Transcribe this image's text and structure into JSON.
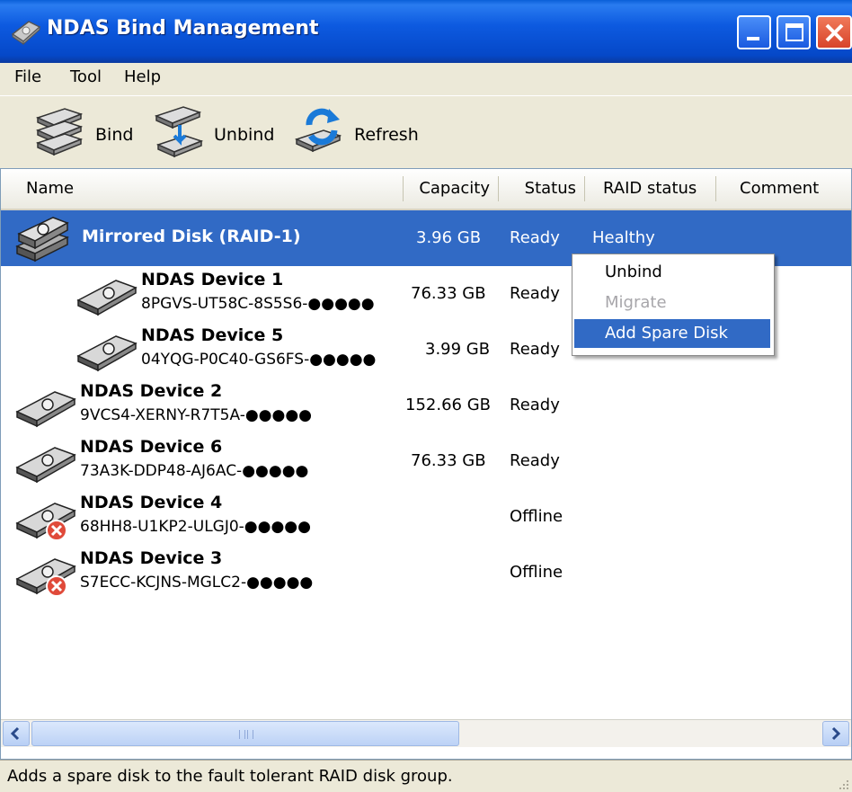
{
  "window": {
    "title": "NDAS Bind Management"
  },
  "menu": [
    "File",
    "Tool",
    "Help"
  ],
  "toolbar": {
    "bind": "Bind",
    "unbind": "Unbind",
    "refresh": "Refresh"
  },
  "columns": [
    "Name",
    "Capacity",
    "Status",
    "RAID status",
    "Comment"
  ],
  "rows": [
    {
      "name": "Mirrored Disk (RAID-1)",
      "serial": "",
      "capacity": "3.96 GB",
      "status": "Ready",
      "raid_status": "Healthy",
      "comment": "",
      "icon": "raid-disk-icon",
      "selected": true
    },
    {
      "name": "NDAS Device 1",
      "serial": "8PGVS-UT58C-8S5S6-●●●●●",
      "capacity": "76.33 GB",
      "status": "Ready",
      "raid_status": "",
      "comment": "",
      "icon": "disk-icon",
      "selected": false
    },
    {
      "name": "NDAS Device 5",
      "serial": "04YQG-P0C40-GS6FS-●●●●●",
      "capacity": "3.99 GB",
      "status": "Ready",
      "raid_status": "",
      "comment": "",
      "icon": "disk-icon",
      "selected": false
    },
    {
      "name": "NDAS Device 2",
      "serial": "9VCS4-XERNY-R7T5A-●●●●●",
      "capacity": "152.66 GB",
      "status": "Ready",
      "raid_status": "",
      "comment": "",
      "icon": "disk-icon",
      "selected": false
    },
    {
      "name": "NDAS Device 6",
      "serial": "73A3K-DDP48-AJ6AC-●●●●●",
      "capacity": "76.33 GB",
      "status": "Ready",
      "raid_status": "",
      "comment": "",
      "icon": "disk-icon",
      "selected": false
    },
    {
      "name": "NDAS Device 4",
      "serial": "68HH8-U1KP2-ULGJ0-●●●●●",
      "capacity": "",
      "status": "Offline",
      "raid_status": "",
      "comment": "",
      "icon": "disk-offline-icon",
      "selected": false
    },
    {
      "name": "NDAS Device 3",
      "serial": "S7ECC-KCJNS-MGLC2-●●●●●",
      "capacity": "",
      "status": "Offline",
      "raid_status": "",
      "comment": "",
      "icon": "disk-offline-icon",
      "selected": false
    }
  ],
  "context_menu": [
    {
      "label": "Unbind",
      "state": "enabled"
    },
    {
      "label": "Migrate",
      "state": "disabled"
    },
    {
      "label": "Add Spare Disk",
      "state": "highlighted"
    }
  ],
  "statusbar": {
    "text": "Adds a spare disk to the fault tolerant RAID disk group."
  },
  "colors": {
    "title_bar": "#0548c8",
    "selection": "#316ac5",
    "window_bg": "#ece9d8",
    "offline_badge": "#e04a3a"
  }
}
